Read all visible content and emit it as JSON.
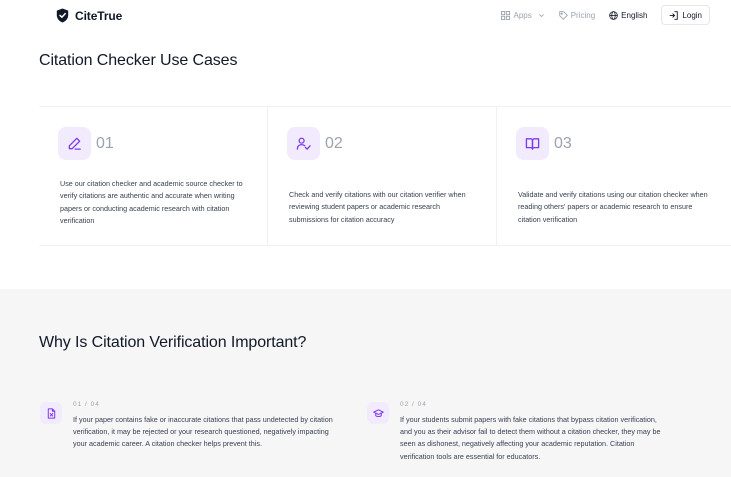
{
  "header": {
    "brand": "CiteTrue",
    "nav": [
      {
        "label": "Apps",
        "icon": "grid-icon"
      },
      {
        "label": "Pricing",
        "icon": "tag-icon"
      },
      {
        "label": "English",
        "icon": "globe-icon"
      }
    ],
    "login_label": "Login"
  },
  "use_cases": {
    "title": "Citation Checker Use Cases",
    "cards": [
      {
        "num": "01",
        "icon": "pen-icon",
        "text": "Use our citation checker and academic source checker to verify citations are authentic and accurate when writing papers or conducting academic research with citation verification"
      },
      {
        "num": "02",
        "icon": "user-check-icon",
        "text": "Check and verify citations with our citation verifier when reviewing student papers or academic research submissions for citation accuracy"
      },
      {
        "num": "03",
        "icon": "book-open-icon",
        "text": "Validate and verify citations using our citation checker when reading others' papers or academic research to ensure citation verification"
      }
    ]
  },
  "why": {
    "title": "Why Is Citation Verification Important?",
    "reasons": [
      {
        "count": "01 / 04",
        "icon": "file-x-icon",
        "text": "If your paper contains fake or inaccurate citations that pass undetected by citation verification, it may be rejected or your research questioned, negatively impacting your academic career. A citation checker helps prevent this."
      },
      {
        "count": "02 / 04",
        "icon": "graduation-cap-icon",
        "text": "If your students submit papers with fake citations that bypass citation verification, and you as their advisor fail to detect them without a citation checker, they may be seen as dishonest, negatively affecting your academic reputation. Citation verification tools are essential for educators."
      }
    ]
  },
  "colors": {
    "accent": "#7c3aed",
    "icon_bg": "#f1ebfd",
    "section_bg": "#f6f6f7"
  }
}
